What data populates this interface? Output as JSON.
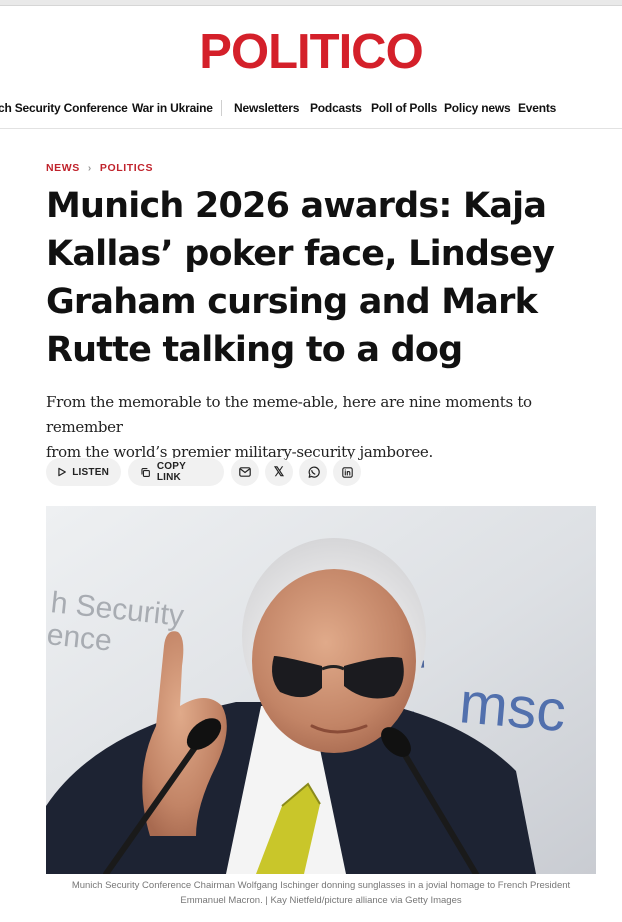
{
  "site": {
    "logo": "POLITICO"
  },
  "nav": {
    "items": [
      "ch Security Conference",
      "War in Ukraine",
      "Newsletters",
      "Podcasts",
      "Poll of Polls",
      "Policy news",
      "Events"
    ]
  },
  "breadcrumb": {
    "section": "NEWS",
    "subsection": "POLITICS",
    "separator": "›"
  },
  "article": {
    "headline_lines": [
      "Munich 2026 awards: Kaja",
      "Kallas’ poker face, Lindsey",
      "Graham cursing and Mark",
      "Rutte talking to a dog"
    ],
    "dek_lines": [
      "From the memorable to the meme-able, here are nine moments to remember",
      "from the world’s premier military-security jamboree."
    ]
  },
  "share": {
    "listen_label": "LISTEN",
    "copy_link_label": "COPY LINK",
    "icons": [
      "email-icon",
      "x-icon",
      "whatsapp-icon",
      "linkedin-icon"
    ],
    "x_glyph": "𝕏"
  },
  "photo": {
    "backdrop_text_1": "h Security",
    "backdrop_text_2": "ence",
    "backdrop_logo": "msc",
    "caption_lines": [
      "Munich Security Conference Chairman Wolfgang Ischinger donning sunglasses in a jovial homage to French President",
      "Emmanuel Macron. | Kay Nietfeld/picture alliance via Getty Images"
    ]
  },
  "colors": {
    "brand": "#d4202a",
    "accent": "#c0232c",
    "tie": "#c9c62a"
  }
}
